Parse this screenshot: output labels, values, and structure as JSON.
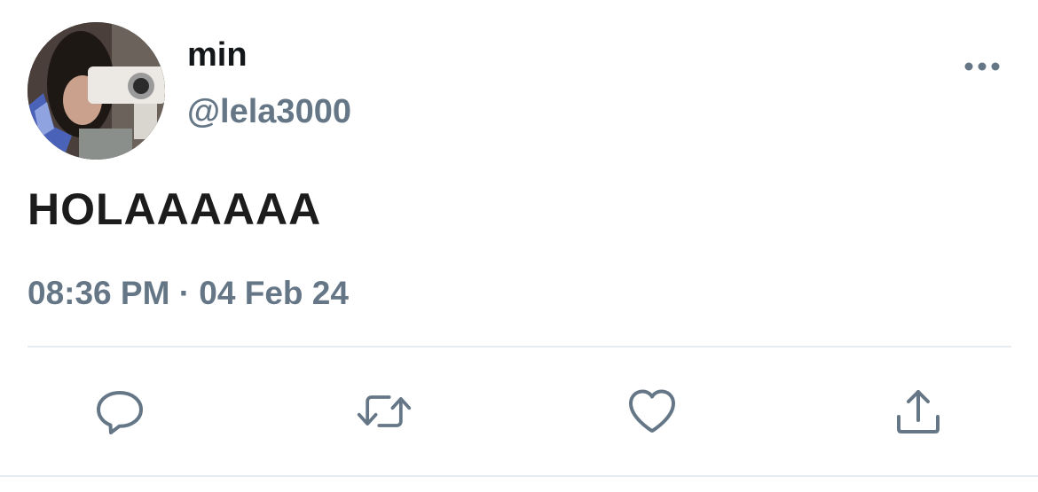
{
  "tweet": {
    "author": {
      "display_name": "min",
      "handle": "@lela3000"
    },
    "text": "HOLAAAAAA",
    "timestamp": "08:36 PM · 04 Feb 24"
  },
  "icons": {
    "more": "more-horizontal-icon",
    "reply": "reply-bubble-icon",
    "retweet": "retweet-arrows-icon",
    "like": "heart-icon",
    "share": "share-upload-icon"
  },
  "colors": {
    "secondary_text": "#657786",
    "primary_text": "#14171a",
    "divider": "#e6ecf0"
  }
}
